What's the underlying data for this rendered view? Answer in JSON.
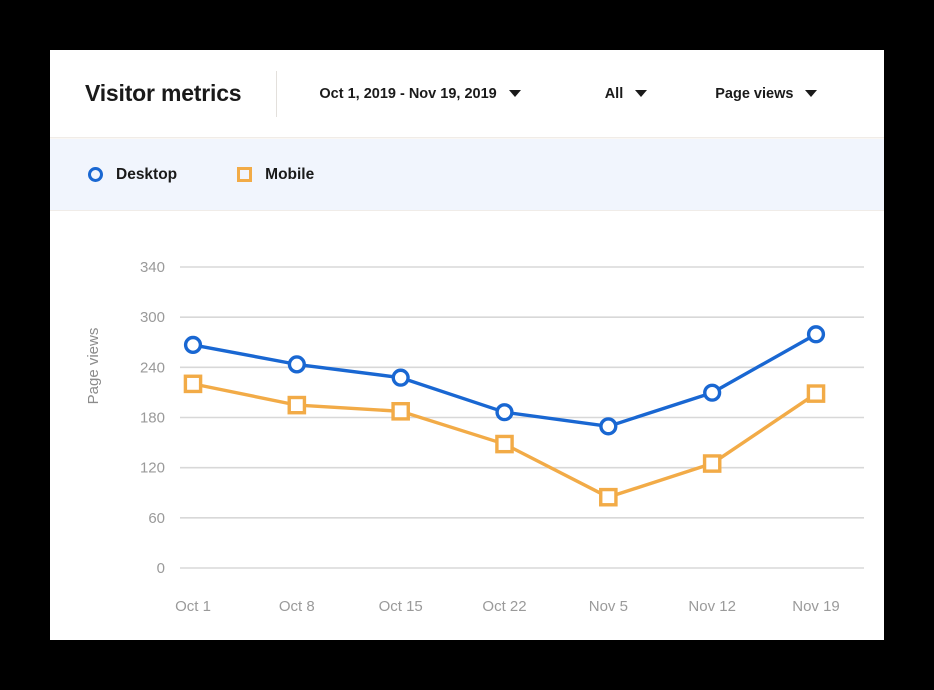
{
  "header": {
    "title": "Visitor metrics",
    "date_range": "Oct 1, 2019 - Nov 19, 2019",
    "segment": "All",
    "metric": "Page views"
  },
  "legend": {
    "items": [
      {
        "label": "Desktop",
        "marker": "circle-icon",
        "color": "#1967D2"
      },
      {
        "label": "Mobile",
        "marker": "square-icon",
        "color": "#F2AB47"
      }
    ]
  },
  "chart_data": {
    "type": "line",
    "title": "Visitor metrics",
    "xlabel": "",
    "ylabel": "Page views",
    "categories": [
      "Oct 1",
      "Oct 8",
      "Oct 15",
      "Oct 22",
      "Nov 5",
      "Nov 12",
      "Nov 19"
    ],
    "ytick_labels": [
      "340",
      "300",
      "240",
      "180",
      "120",
      "60",
      "0"
    ],
    "ytick_values": [
      340,
      300,
      240,
      180,
      120,
      60,
      0
    ],
    "ylim": [
      0,
      340
    ],
    "grid": true,
    "legend_position": "top-left",
    "series": [
      {
        "name": "Desktop",
        "color": "#1967D2",
        "marker": "circle",
        "values": [
          252,
          230,
          215,
          176,
          160,
          198,
          264
        ]
      },
      {
        "name": "Mobile",
        "color": "#F2AB47",
        "marker": "square",
        "values": [
          208,
          184,
          177,
          140,
          80,
          118,
          197
        ]
      }
    ]
  }
}
